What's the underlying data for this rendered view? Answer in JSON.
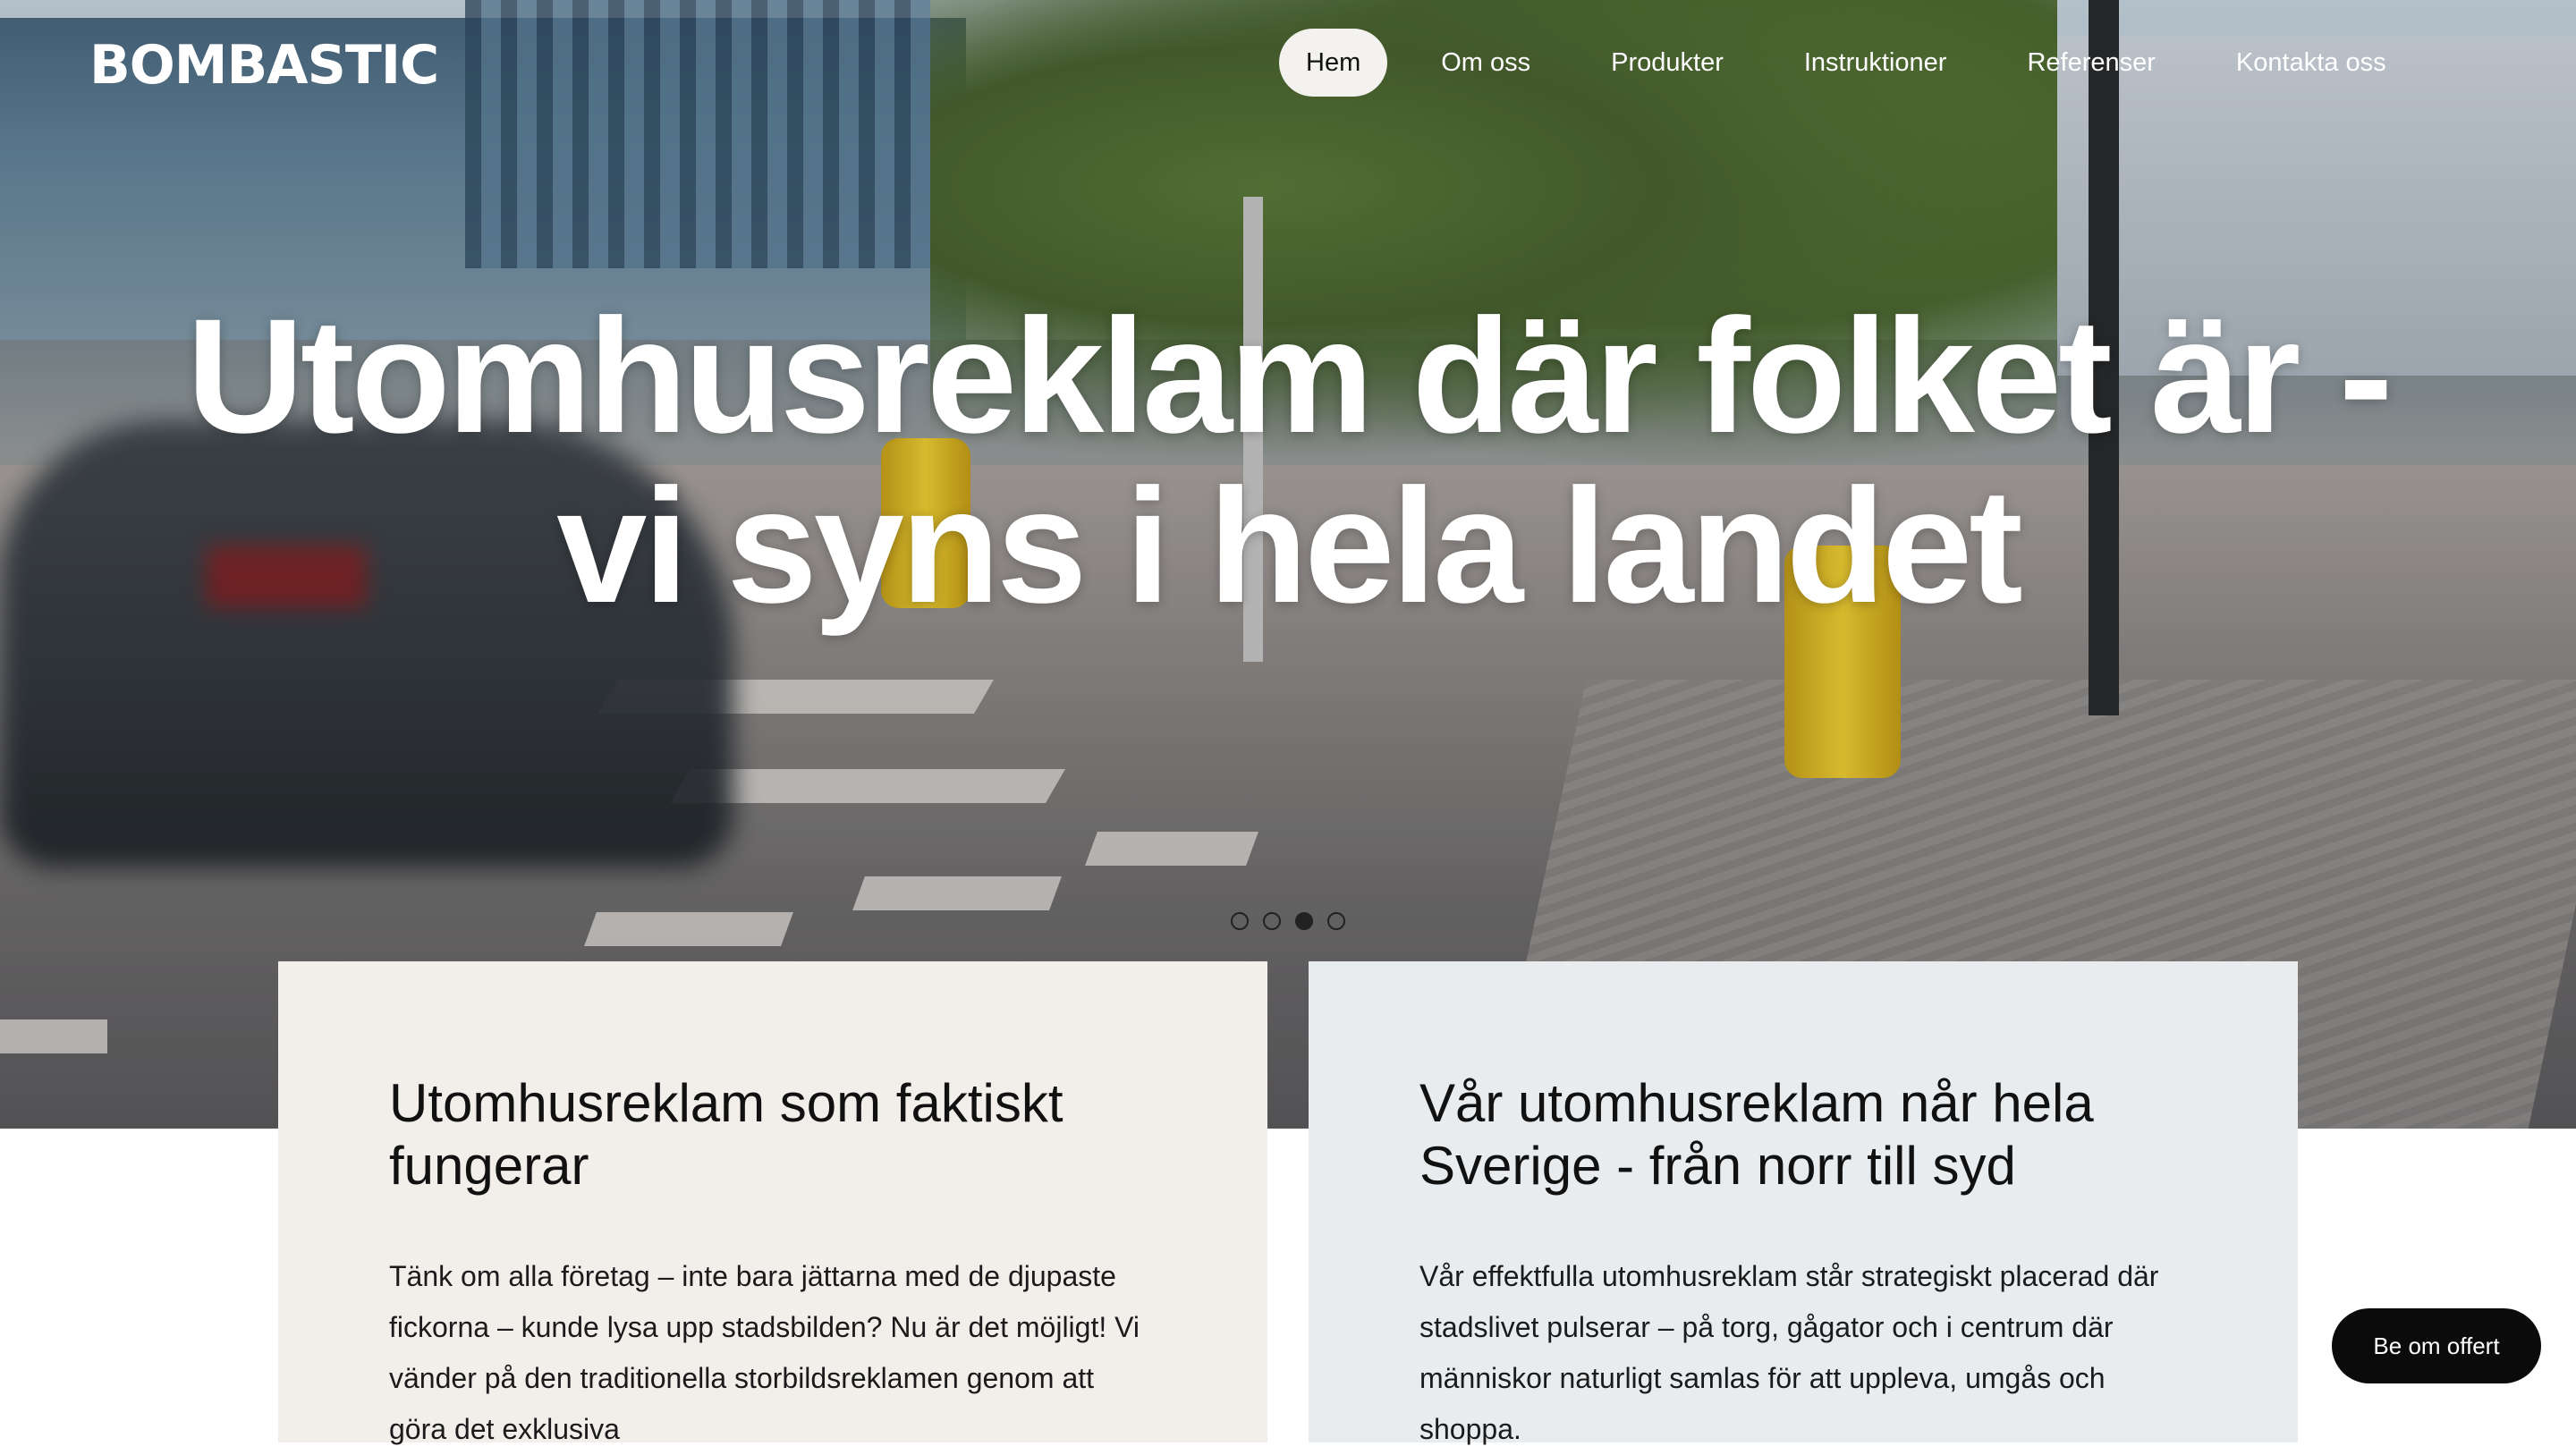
{
  "brand": {
    "logo_text": "BOMBASTIC"
  },
  "nav": {
    "items": [
      {
        "label": "Hem",
        "active": true
      },
      {
        "label": "Om oss"
      },
      {
        "label": "Produkter"
      },
      {
        "label": "Instruktioner"
      },
      {
        "label": "Referenser"
      },
      {
        "label": "Kontakta oss"
      }
    ]
  },
  "hero": {
    "title_line1": "Utomhusreklam där folket är -",
    "title_line2": "vi syns i hela landet",
    "slides": {
      "count": 4,
      "active_index": 3
    }
  },
  "cards": [
    {
      "title": "Utomhusreklam som faktiskt fungerar",
      "body": "Tänk om alla företag – inte bara jättarna med de djupaste fickorna – kunde lysa upp stadsbilden? Nu är det möjligt! Vi vänder på den traditionella storbildsreklamen genom att göra det exklusiva"
    },
    {
      "title": "Vår utomhusreklam når hela Sverige - från norr till syd",
      "body": "Vår effektfulla utomhusreklam står strategiskt placerad där stadslivet pulserar – på torg, gågator och i centrum där människor naturligt samlas för att uppleva, umgås och shoppa."
    }
  ],
  "cta": {
    "offer_label": "Be om offert"
  },
  "colors": {
    "card_left_bg": "#f2efeb",
    "card_right_bg": "#e9ecef",
    "cta_bg": "#0b0b0b",
    "nav_active_bg": "#f4f2ef"
  }
}
